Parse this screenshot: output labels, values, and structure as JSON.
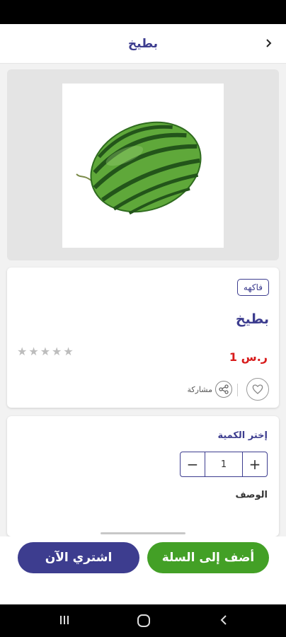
{
  "header": {
    "title": "بطيخ"
  },
  "product": {
    "category": "فاكهه",
    "name": "بطيخ",
    "price": "1 ر.س",
    "rating": 0,
    "rating_max": 5,
    "stars": [
      "★",
      "★",
      "★",
      "★",
      "★"
    ],
    "share_label": "مشاركة"
  },
  "quantity": {
    "title": "إختر الكمية",
    "value": "1",
    "plus": "+",
    "minus": "−"
  },
  "description": {
    "title": "الوصف"
  },
  "actions": {
    "add_to_cart": "أضف إلى السلة",
    "buy_now": "اشتري الآن"
  },
  "colors": {
    "primary": "#3d3d8f",
    "green": "#43a026",
    "price": "#d81b1b"
  }
}
